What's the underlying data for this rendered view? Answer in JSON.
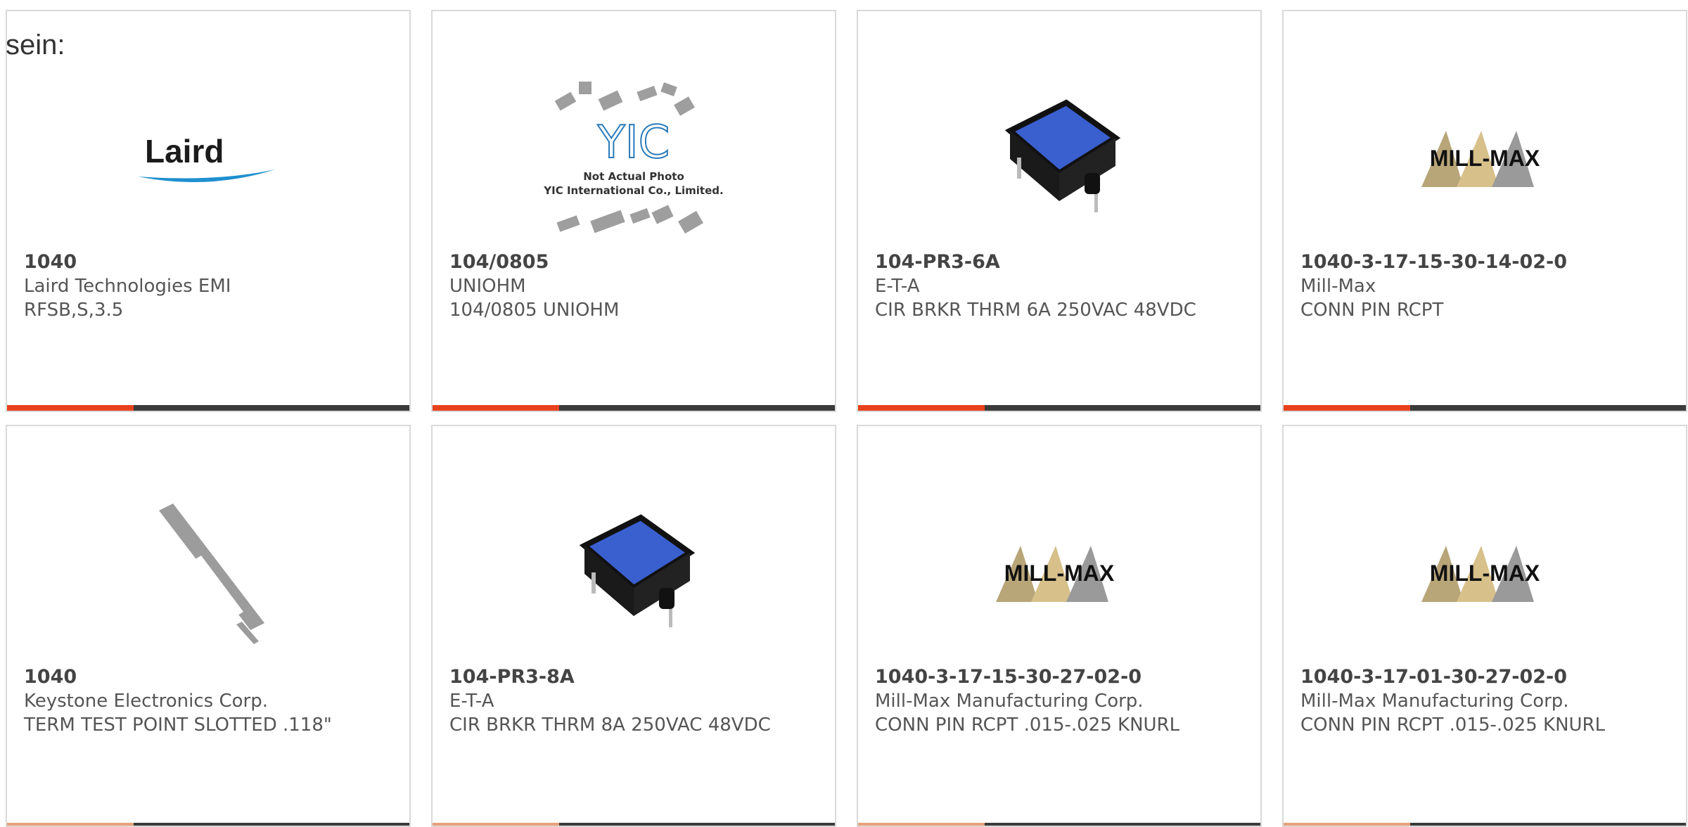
{
  "intro_text": "sein:",
  "colors": {
    "accent": "#e8431c",
    "bar": "#3b3b3b",
    "border": "#d9d9d9"
  },
  "products": [
    {
      "part": "1040",
      "manufacturer": "Laird Technologies EMI",
      "description": "RFSB,S,3.5",
      "image": "laird-logo",
      "logo_text": "Laird"
    },
    {
      "part": "104/0805",
      "manufacturer": "UNIOHM",
      "description": "104/0805 UNIOHM",
      "image": "yic-not-actual-photo",
      "logo_text": "YIC",
      "caption_1": "Not Actual Photo",
      "caption_2": "YIC International Co., Limited."
    },
    {
      "part": "104-PR3-6A",
      "manufacturer": "E-T-A",
      "description": "CIR BRKR THRM 6A 250VAC 48VDC",
      "image": "circuit-breaker-photo"
    },
    {
      "part": "1040-3-17-15-30-14-02-0",
      "manufacturer": "Mill-Max",
      "description": "CONN PIN RCPT",
      "image": "mill-max-logo",
      "logo_text": "MILL-MAX"
    },
    {
      "part": "1040",
      "manufacturer": "Keystone Electronics Corp.",
      "description": "TERM TEST POINT SLOTTED .118\"",
      "image": "test-point-photo"
    },
    {
      "part": "104-PR3-8A",
      "manufacturer": "E-T-A",
      "description": "CIR BRKR THRM 8A 250VAC 48VDC",
      "image": "circuit-breaker-photo"
    },
    {
      "part": "1040-3-17-15-30-27-02-0",
      "manufacturer": "Mill-Max Manufacturing Corp.",
      "description": "CONN PIN RCPT .015-.025 KNURL",
      "image": "mill-max-logo",
      "logo_text": "MILL-MAX"
    },
    {
      "part": "1040-3-17-01-30-27-02-0",
      "manufacturer": "Mill-Max Manufacturing Corp.",
      "description": "CONN PIN RCPT .015-.025 KNURL",
      "image": "mill-max-logo",
      "logo_text": "MILL-MAX"
    }
  ]
}
